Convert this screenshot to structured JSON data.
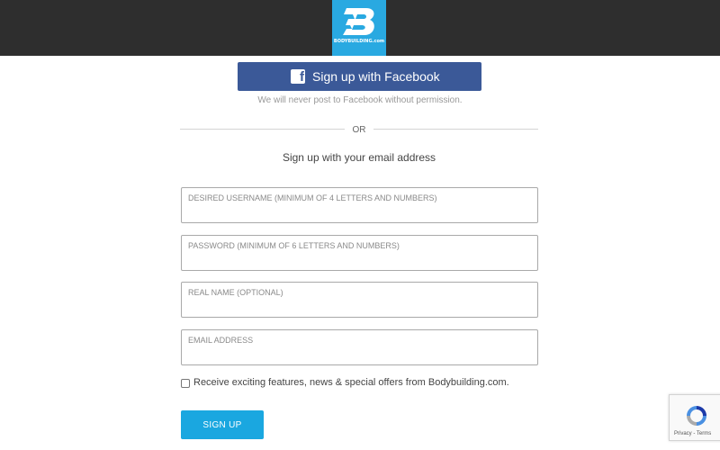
{
  "header": {
    "logo_text": "BODYBUILDING.com",
    "colors": {
      "bar": "#2e2e2e",
      "logo_bg": "#29a9e1"
    }
  },
  "facebook": {
    "button_label": "Sign up with Facebook",
    "icon": "facebook-icon",
    "note": "We will never post to Facebook without permission.",
    "color": "#3b5998"
  },
  "divider": {
    "or_label": "OR"
  },
  "form": {
    "subtitle": "Sign up with your email address",
    "fields": [
      {
        "label": "DESIRED USERNAME (MINIMUM OF 4 LETTERS AND NUMBERS)",
        "value": ""
      },
      {
        "label": "PASSWORD (MINIMUM OF 6 LETTERS AND NUMBERS)",
        "value": ""
      },
      {
        "label": "REAL NAME (OPTIONAL)",
        "value": ""
      },
      {
        "label": "EMAIL ADDRESS",
        "value": ""
      }
    ],
    "checkbox_label": "Receive exciting features, news & special offers from Bodybuilding.com.",
    "checkbox_checked": false,
    "submit_label": "SIGN UP",
    "submit_color": "#1aa7e0"
  },
  "recaptcha": {
    "icon": "recaptcha-icon",
    "links": "Privacy - Terms"
  }
}
